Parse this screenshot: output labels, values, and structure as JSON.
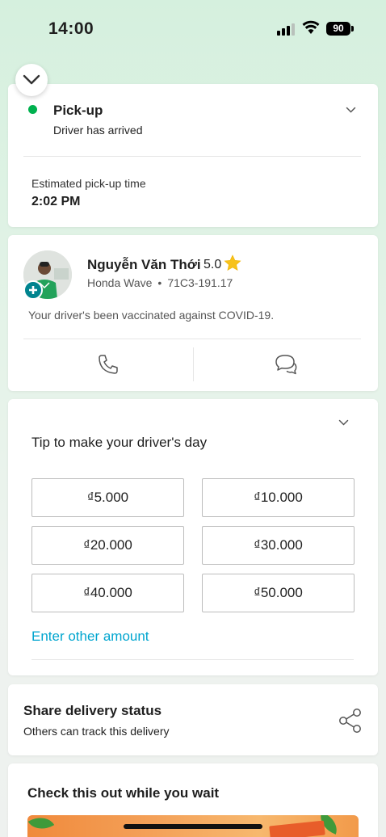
{
  "status_bar": {
    "time": "14:00",
    "battery": "90"
  },
  "pickup": {
    "title": "Pick-up",
    "status": "Driver has arrived",
    "eta_label": "Estimated pick-up time",
    "eta_value": "2:02 PM"
  },
  "driver": {
    "name": "Nguyễn Văn Thới",
    "rating": "5.0",
    "vehicle_model": "Honda Wave",
    "separator": "•",
    "plate": "71C3-191.17",
    "vaccination_note": "Your driver's been vaccinated against COVID-19."
  },
  "tip": {
    "title": "Tip to make your driver's day",
    "options": [
      "₫5.000",
      "₫10.000",
      "₫20.000",
      "₫30.000",
      "₫40.000",
      "₫50.000"
    ],
    "other_amount": "Enter other amount"
  },
  "share": {
    "title": "Share delivery status",
    "subtitle": "Others can track this delivery"
  },
  "promo": {
    "title": "Check this out while you wait"
  },
  "colors": {
    "accent_green": "#00b14f",
    "link_blue": "#00a5cf",
    "shield_teal": "#00848f",
    "star_yellow": "#f7c21b"
  },
  "icons": [
    "chevron-down-icon",
    "phone-icon",
    "chat-icon",
    "share-icon",
    "star-icon",
    "shield-plus-icon",
    "wifi-icon",
    "signal-icon",
    "battery-icon"
  ]
}
